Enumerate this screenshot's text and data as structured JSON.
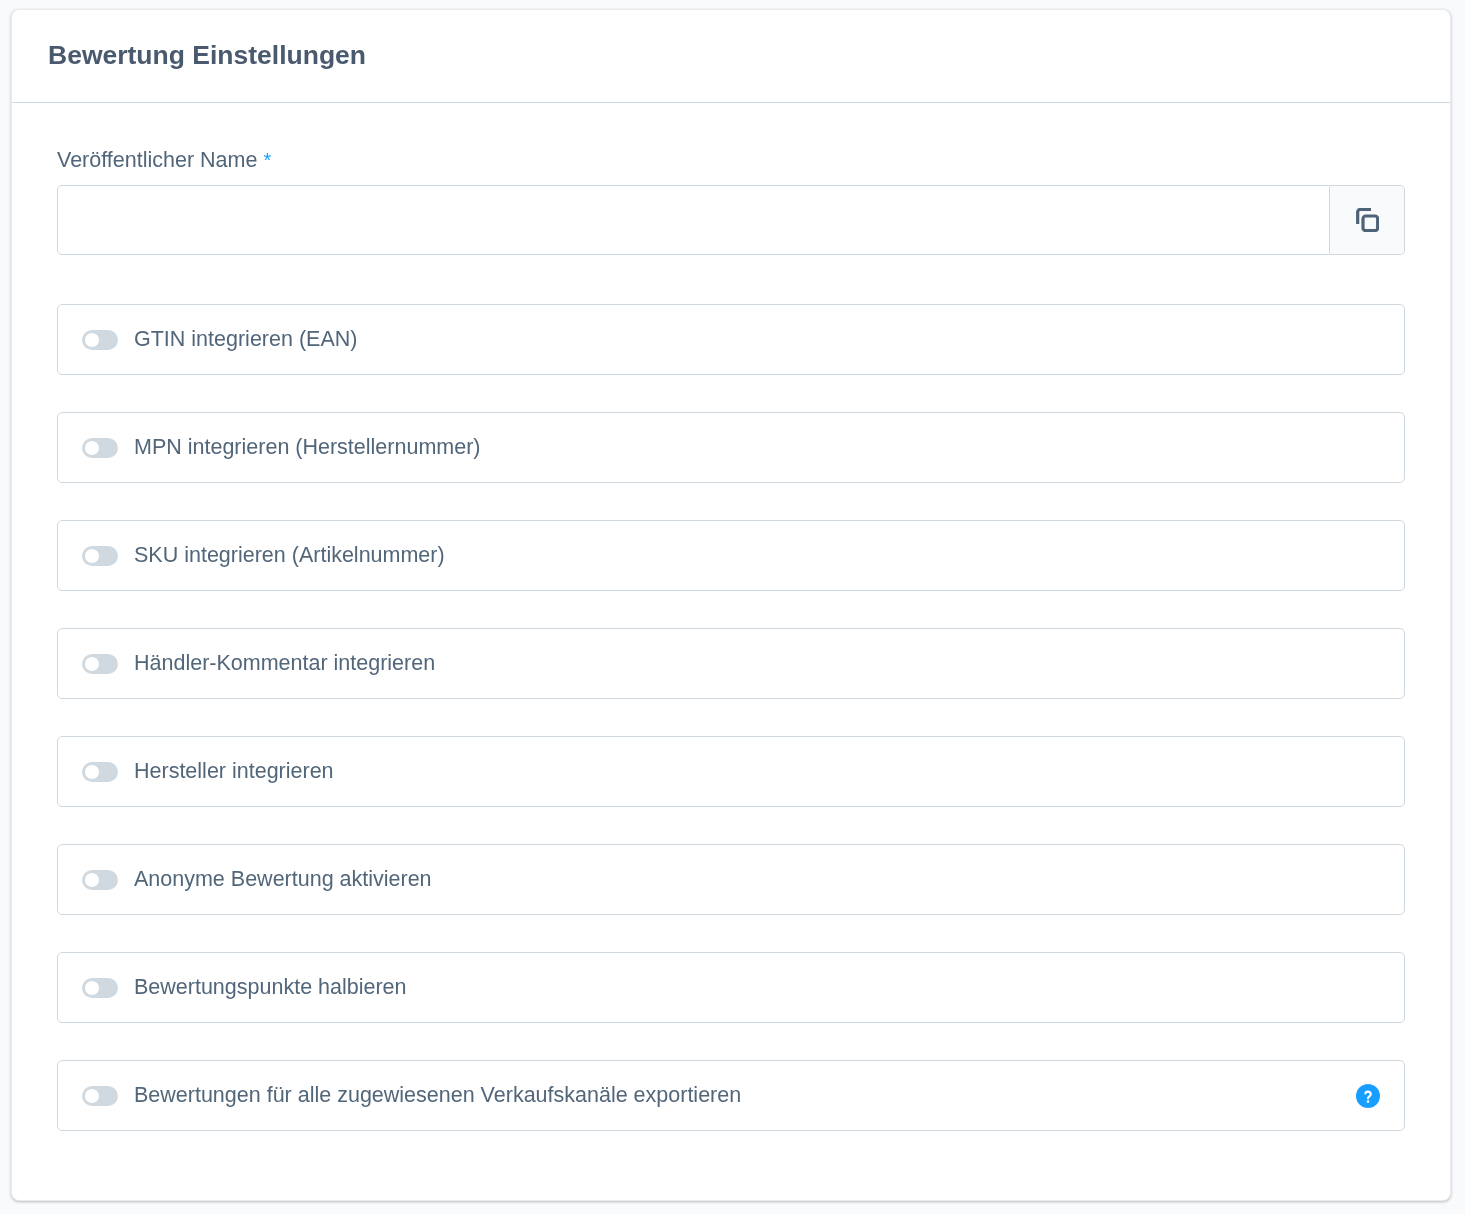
{
  "card": {
    "title": "Bewertung Einstellungen"
  },
  "name_field": {
    "label": "Veröffentlicher Name",
    "required_mark": "*"
  },
  "toggles": [
    {
      "label": "GTIN integrieren (EAN)",
      "on": false,
      "help": false
    },
    {
      "label": "MPN integrieren (Herstellernummer)",
      "on": false,
      "help": false
    },
    {
      "label": "SKU integrieren (Artikelnummer)",
      "on": false,
      "help": false
    },
    {
      "label": "Händler-Kommentar integrieren",
      "on": false,
      "help": false
    },
    {
      "label": "Hersteller integrieren",
      "on": false,
      "help": false
    },
    {
      "label": "Anonyme Bewertung aktivieren",
      "on": false,
      "help": false
    },
    {
      "label": "Bewertungspunkte halbieren",
      "on": false,
      "help": false
    },
    {
      "label": "Bewertungen für alle zugewiesenen Verkaufskanäle exportieren",
      "on": false,
      "help": true
    }
  ]
}
